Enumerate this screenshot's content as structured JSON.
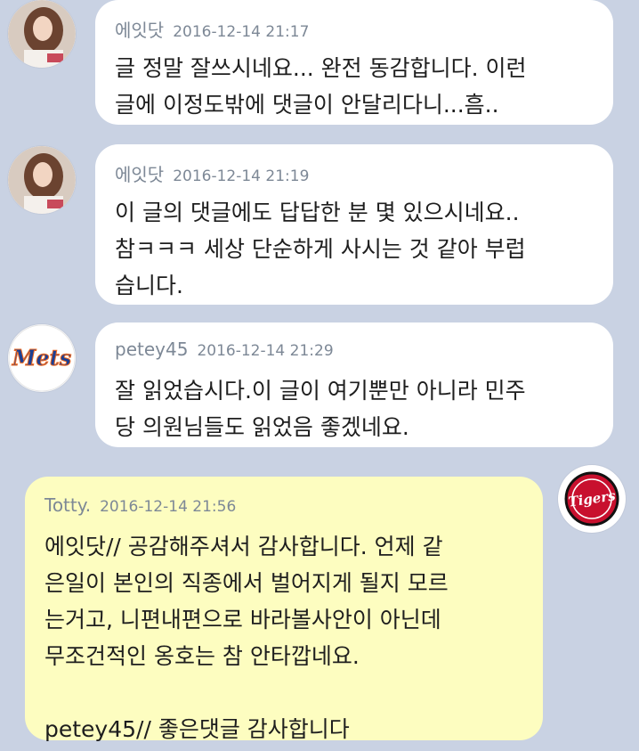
{
  "colors": {
    "background": "#c9d2e3",
    "bubble_left": "#ffffff",
    "bubble_right": "#fdfdc0",
    "meta_text": "#7d8896",
    "body_text": "#1e1e1e"
  },
  "messages": [
    {
      "name": "에잇닷",
      "time": "2016-12-14 21:17",
      "text": "글 정말 잘쓰시네요... 완전 동감합니다. 이런\n글에 이정도밖에 댓글이 안달리다니...흠..",
      "avatar_icon": "user-photo-icon"
    },
    {
      "name": "에잇닷",
      "time": "2016-12-14 21:19",
      "text": "이 글의 댓글에도 답답한 분 몇 있으시네요..\n참ㅋㅋㅋ 세상 단순하게 사시는 것 같아 부럽\n습니다.",
      "avatar_icon": "user-photo-icon"
    },
    {
      "name": "petey45",
      "time": "2016-12-14 21:29",
      "text": "잘 읽었습시다.이 글이 여기뿐만 아니라 민주\n당 의원님들도 읽었음 좋겠네요.",
      "avatar_icon": "mets-logo-icon",
      "avatar_logo_text": "Mets"
    },
    {
      "name": "Totty.",
      "time": "2016-12-14 21:56",
      "text": "에잇닷// 공감해주셔서 감사합니다. 언제 같\n은일이 본인의 직종에서 벌어지게 될지 모르\n는거고, 니편내편으로 바라볼사안이 아닌데\n무조건적인 옹호는 참 안타깝네요.\n\npetey45// 좋은댓글 감사합니다",
      "avatar_icon": "tigers-logo-icon",
      "avatar_logo_text": "Tigers"
    }
  ]
}
